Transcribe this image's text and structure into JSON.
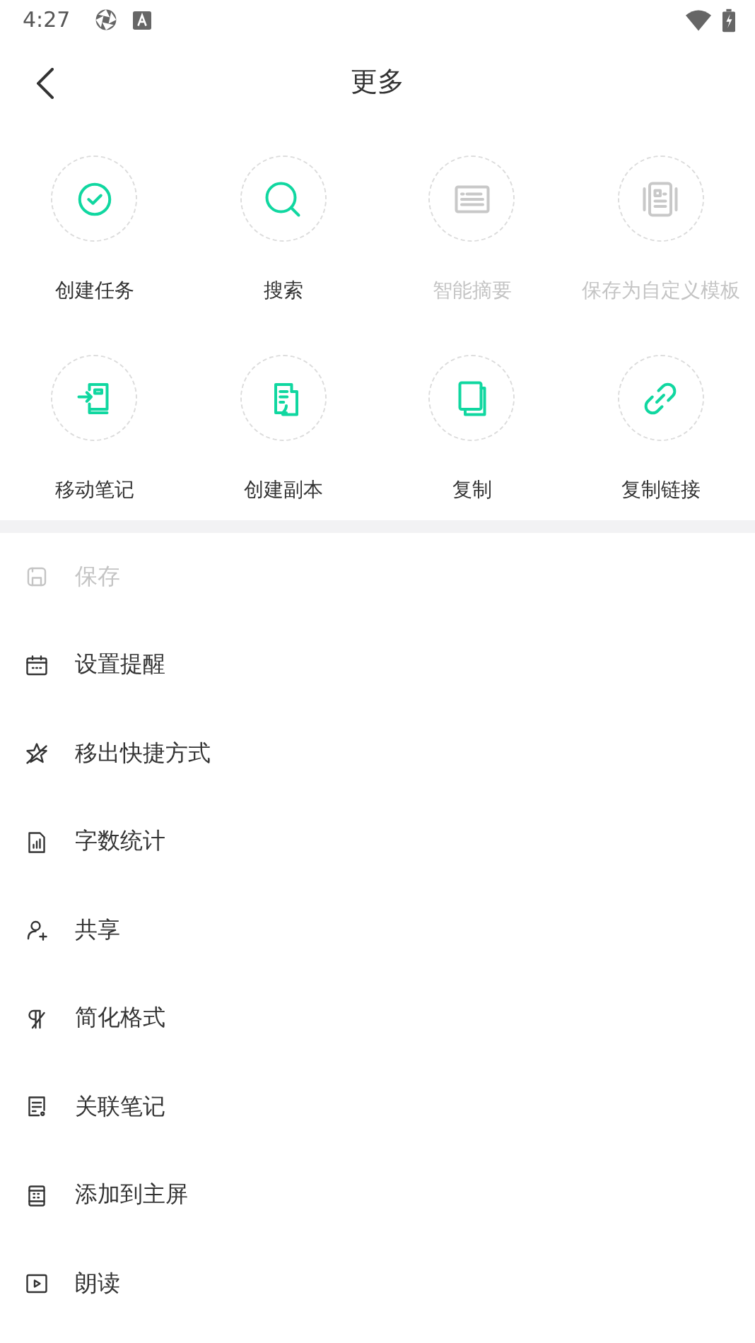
{
  "status_bar": {
    "time": "4:27"
  },
  "header": {
    "title": "更多"
  },
  "actions": [
    {
      "label": "创建任务",
      "disabled": false
    },
    {
      "label": "搜索",
      "disabled": false
    },
    {
      "label": "智能摘要",
      "disabled": true
    },
    {
      "label": "保存为自定义模板",
      "disabled": true
    },
    {
      "label": "移动笔记",
      "disabled": false
    },
    {
      "label": "创建副本",
      "disabled": false
    },
    {
      "label": "复制",
      "disabled": false
    },
    {
      "label": "复制链接",
      "disabled": false
    }
  ],
  "menu": [
    {
      "label": "保存",
      "disabled": true
    },
    {
      "label": "设置提醒",
      "disabled": false
    },
    {
      "label": "移出快捷方式",
      "disabled": false
    },
    {
      "label": "字数统计",
      "disabled": false
    },
    {
      "label": "共享",
      "disabled": false
    },
    {
      "label": "简化格式",
      "disabled": false
    },
    {
      "label": "关联笔记",
      "disabled": false
    },
    {
      "label": "添加到主屏",
      "disabled": false
    },
    {
      "label": "朗读",
      "disabled": false
    }
  ]
}
